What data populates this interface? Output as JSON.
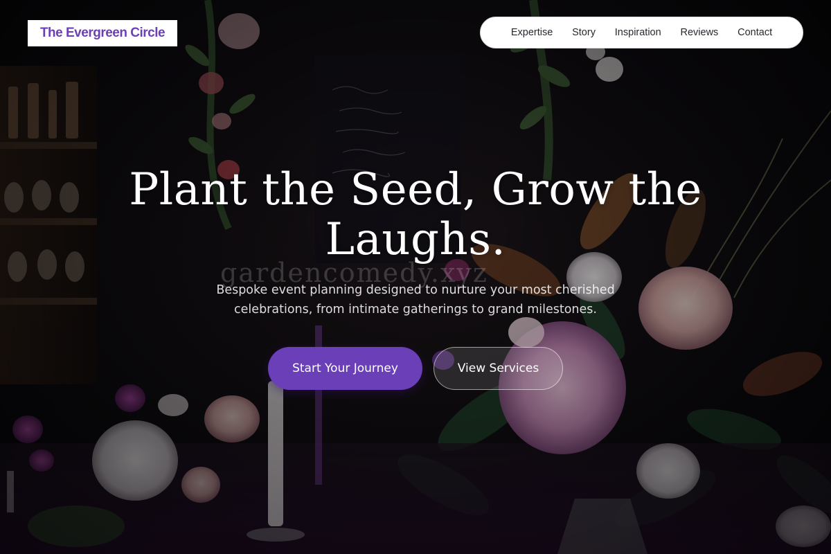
{
  "brand": {
    "name": "The Evergreen Circle",
    "color": "#6b3fb8"
  },
  "nav": {
    "items": [
      {
        "label": "Expertise"
      },
      {
        "label": "Story"
      },
      {
        "label": "Inspiration"
      },
      {
        "label": "Reviews"
      },
      {
        "label": "Contact"
      }
    ]
  },
  "hero": {
    "headline": "Plant the Seed, Grow the Laughs.",
    "subtext": "Bespoke event planning designed to nurture your most cherished celebrations, from intimate gatherings to grand milestones.",
    "watermark": "gardencomedy.xyz",
    "primary_button": "Start Your Journey",
    "secondary_button": "View Services",
    "background_image": "dark floral table arrangement with dahlias, roses, magnolia leaves and candles"
  },
  "colors": {
    "accent": "#6a3fb8",
    "text_light": "#ffffff",
    "nav_bg": "#ffffff"
  }
}
